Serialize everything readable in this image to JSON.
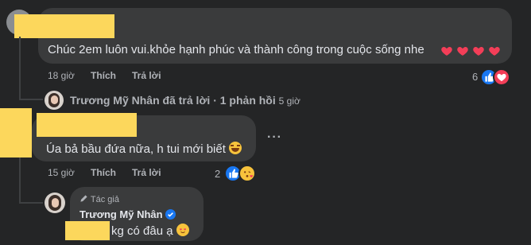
{
  "comment1": {
    "text": "Chúc 2em luôn vui.khỏe hạnh phúc và thành công trong cuộc sống nhe",
    "time": "18 giờ",
    "like": "Thích",
    "reply": "Trả lời",
    "reaction_count": "6"
  },
  "replies_summary": {
    "author": "Trương Mỹ Nhân",
    "action": "đã trả lời",
    "separator": "·",
    "count_text": "1 phản hồi",
    "time": "5 giờ"
  },
  "comment2": {
    "text": "Úa bả bầu đứa nữa, h tui mới biết",
    "time": "15 giờ",
    "like": "Thích",
    "reply": "Trả lời",
    "reaction_count": "2",
    "more": "···"
  },
  "comment3": {
    "badge": "Tác giả",
    "author": "Trương Mỹ Nhân",
    "text": "kg có đâu ạ"
  },
  "colors": {
    "background": "#242526",
    "bubble": "#3a3b3c",
    "like_blue": "#1877f2",
    "heart_red": "#f33e58",
    "redaction_yellow": "#fcd75c"
  },
  "icons": [
    "heart-icon",
    "like-icon",
    "laugh-emoji-icon",
    "love-react-icon",
    "kiss-emoji-icon",
    "verified-icon",
    "pencil-icon",
    "more-icon"
  ]
}
